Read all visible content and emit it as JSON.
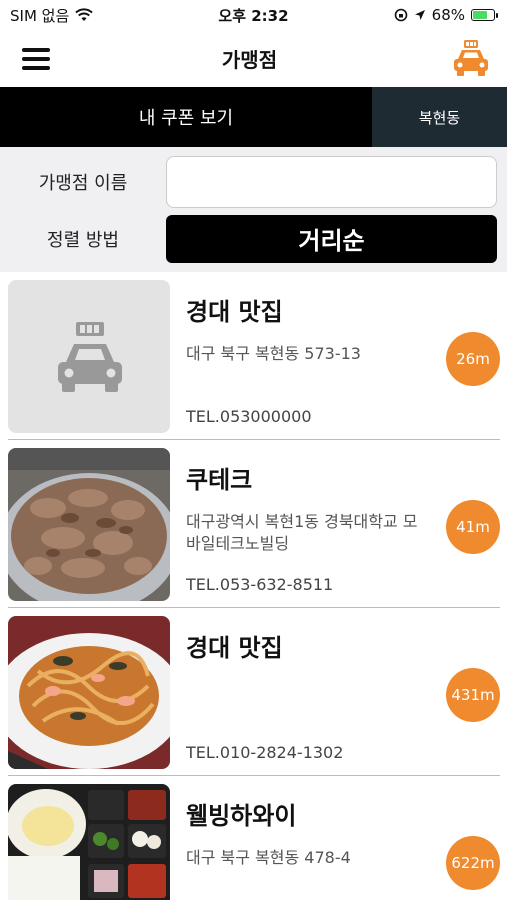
{
  "status_bar": {
    "carrier": "SIM 없음",
    "time": "오후 2:32",
    "battery_percent": "68%",
    "battery_level": 0.68,
    "icons": [
      "wifi-icon",
      "orientation-lock-icon",
      "location-arrow-icon",
      "battery-icon"
    ]
  },
  "nav": {
    "title": "가맹점",
    "menu_icon": "hamburger-menu-icon",
    "logo_icon": "taxi-logo-icon"
  },
  "tabs": {
    "coupon_label": "내 쿠폰 보기",
    "region_label": "복현동"
  },
  "filter": {
    "name_label": "가맹점 이름",
    "name_value": "",
    "name_placeholder": "",
    "sort_label": "정렬 방법",
    "sort_value": "거리순"
  },
  "colors": {
    "accent": "#f08a2e",
    "black": "#000000",
    "region_tab_bg": "#1f2b33",
    "filter_bg": "#f0f0f2"
  },
  "stores": [
    {
      "name": "경대 맛집",
      "address": "대구 북구 복현동 573-13",
      "tel": "TEL.053000000",
      "distance": "26m",
      "image": "placeholder-taxi"
    },
    {
      "name": "쿠테크",
      "address": "대구광역시 복현1동 경북대학교 모바일테크노빌딩",
      "tel": "TEL.053-632-8511",
      "distance": "41m",
      "image": "bbq-meat-photo"
    },
    {
      "name": "경대 맛집",
      "address": "",
      "tel": "TEL.010-2824-1302",
      "distance": "431m",
      "image": "noodle-dish-photo"
    },
    {
      "name": "웰빙하와이",
      "address": "대구 북구 복현동 478-4",
      "tel": "",
      "distance": "622m",
      "image": "lunchbox-photo"
    }
  ]
}
